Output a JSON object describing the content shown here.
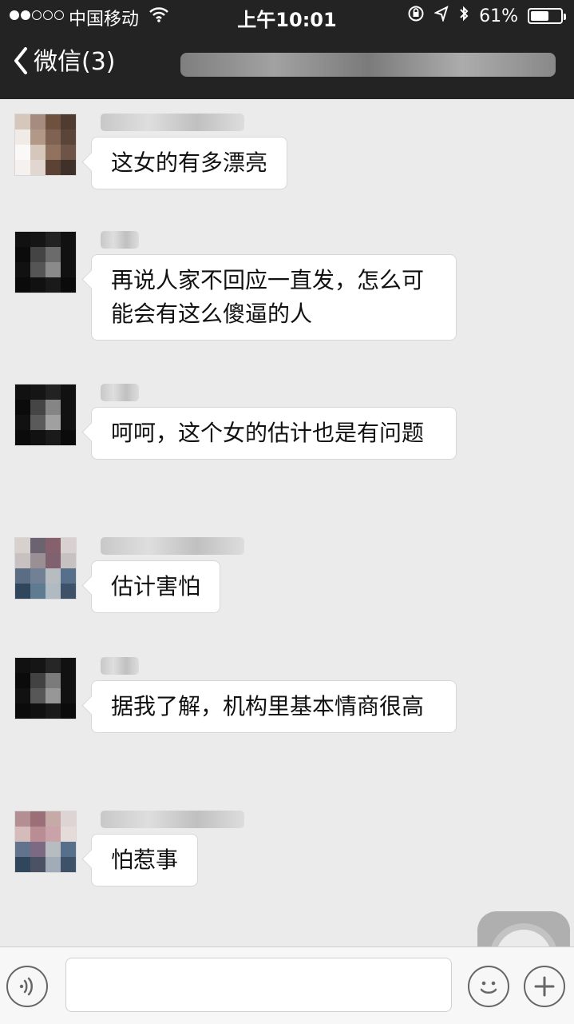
{
  "status_bar": {
    "carrier": "中国移动",
    "time": "上午10:01",
    "battery": "61%",
    "battery_level": 61,
    "icons": [
      "signal-dots",
      "wifi-icon",
      "lock-rotation-icon",
      "location-icon",
      "bluetooth-icon",
      "battery-icon"
    ]
  },
  "nav": {
    "back_label": "微信(3)",
    "title": "",
    "back_icon": "chevron-left-icon"
  },
  "messages": [
    {
      "id": "m1",
      "sender": "",
      "text": "这女的有多漂亮",
      "avatar_colors": [
        "#d4c2b5",
        "#9c7f6c",
        "#6f5140",
        "#4f3b2f"
      ]
    },
    {
      "id": "m2",
      "sender": "",
      "text": "再说人家不回应一直发，怎么可能会有这么傻逼的人",
      "avatar_colors": [
        "#111111",
        "#303030",
        "#5b5b5b",
        "#909090"
      ]
    },
    {
      "id": "m3",
      "sender": "",
      "text": "呵呵，这个女的估计也是有问题",
      "avatar_colors": [
        "#111111",
        "#2a2a2a",
        "#5a5a5a",
        "#8f8f8f"
      ]
    },
    {
      "id": "m4",
      "sender": "",
      "text": "估计害怕",
      "avatar_colors": [
        "#4b5c74",
        "#b6bec5",
        "#86606d",
        "#d7d0cd"
      ]
    },
    {
      "id": "m5",
      "sender": "",
      "text": "据我了解，机构里基本情商很高",
      "avatar_colors": [
        "#111111",
        "#2f2f2f",
        "#616161",
        "#979797"
      ]
    },
    {
      "id": "m6",
      "sender": "",
      "text": "怕惹事",
      "avatar_colors": [
        "#9a6f78",
        "#c6aaa8",
        "#4b5264",
        "#d9d1cf"
      ]
    }
  ],
  "input_bar": {
    "voice_icon": "voice-icon",
    "emoji_icon": "emoji-icon",
    "plus_icon": "plus-icon",
    "input_value": ""
  }
}
